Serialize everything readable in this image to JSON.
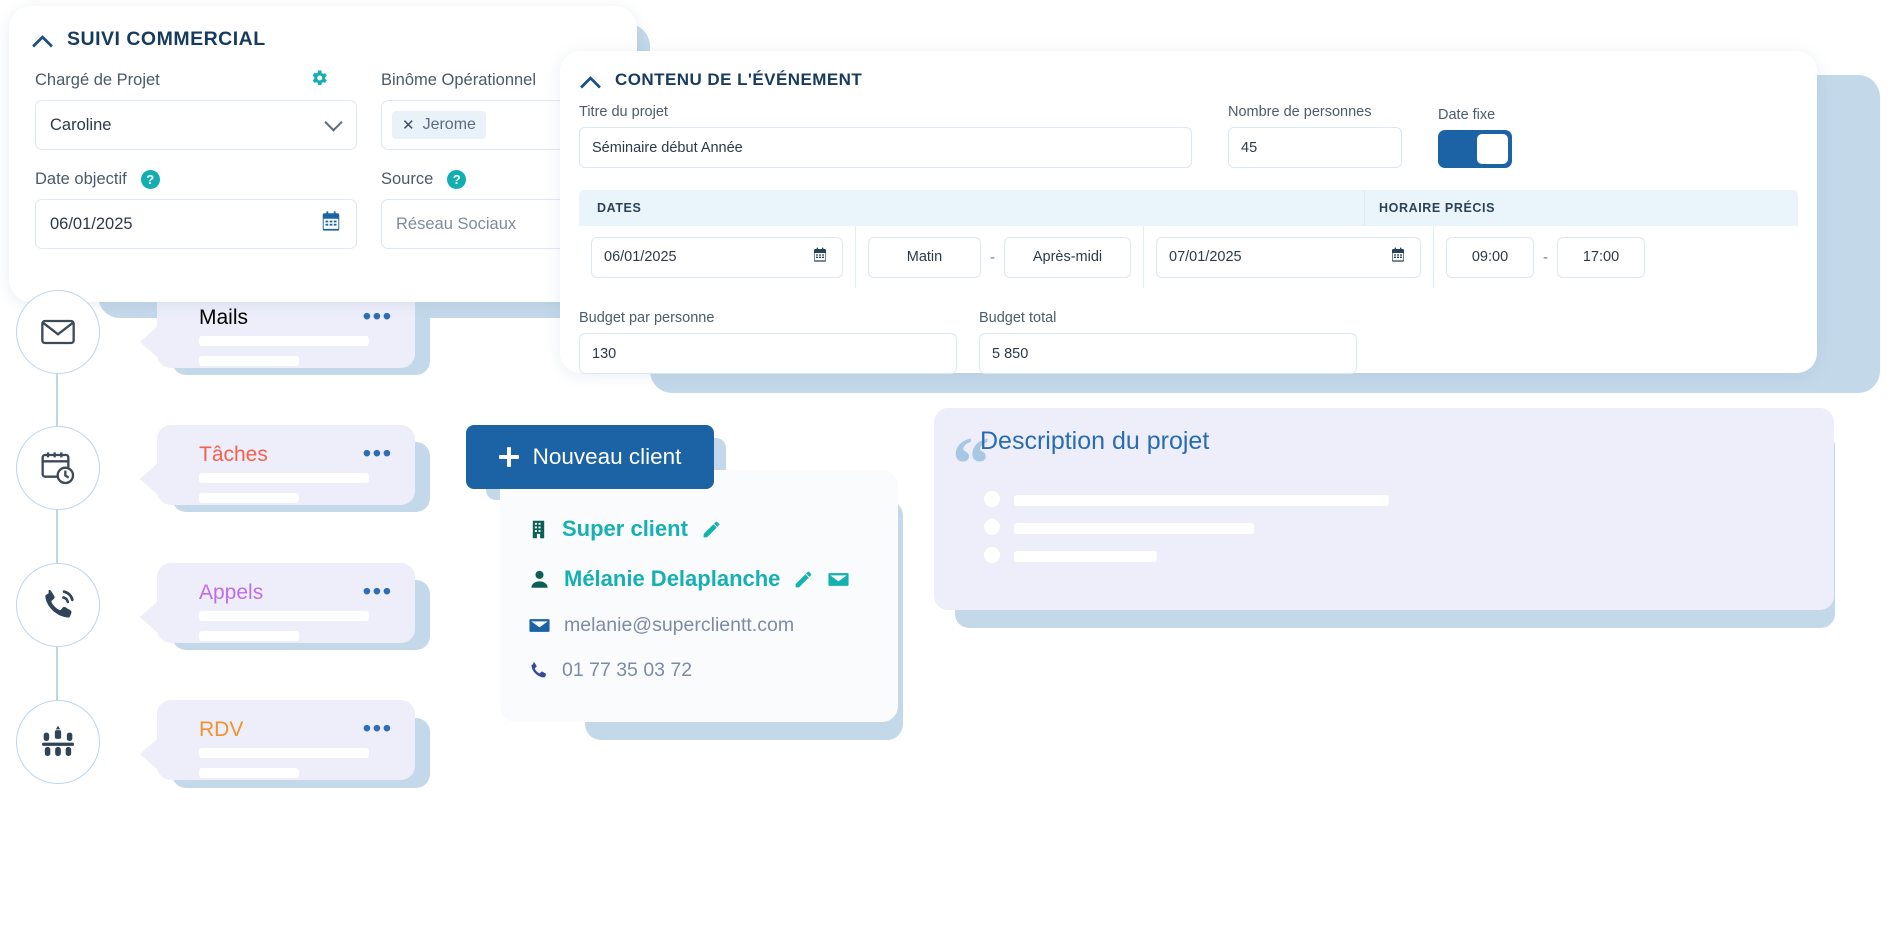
{
  "suivi": {
    "title": "SUIVI COMMERCIAL",
    "collapse_icon": "chevron-up-icon",
    "fields": {
      "charge_projet_label": "Chargé de Projet",
      "charge_projet_value": "Caroline",
      "gear_icon": "gear-icon",
      "binome_label": "Binôme Opérationnel",
      "binome_tag": "Jerome",
      "binome_tag_remove": "✕",
      "date_objectif_label": "Date objectif",
      "date_objectif_value": "06/01/2025",
      "date_objectif_help": "?",
      "source_label": "Source",
      "source_help": "?",
      "source_value": "Réseau Sociaux"
    }
  },
  "event": {
    "title": "CONTENU DE L'ÉVÉNEMENT",
    "collapse_icon": "chevron-up-icon",
    "titre_projet_label": "Titre du projet",
    "titre_projet_value": "Séminaire début Année",
    "nombre_personnes_label": "Nombre de personnes",
    "nombre_personnes_value": "45",
    "date_fixe_label": "Date fixe",
    "date_fixe_state": "on",
    "table": {
      "col_dates": "DATES",
      "col_horaire": "HORAIRE PRÉCIS",
      "start_date": "06/01/2025",
      "start_period": "Matin",
      "period_separator": "-",
      "end_period": "Après-midi",
      "end_date": "07/01/2025",
      "start_time": "09:00",
      "time_separator": "-",
      "end_time": "17:00"
    },
    "budget_personne_label": "Budget par personne",
    "budget_personne_value": "130",
    "budget_total_label": "Budget total",
    "budget_total_value": "5 850"
  },
  "timeline": [
    {
      "icon": "envelope-icon",
      "label": "Mails",
      "color": "#2b6cb0",
      "menu": "•••"
    },
    {
      "icon": "calendar-clock-icon",
      "label": "Tâches",
      "color": "#f4604f",
      "menu": "•••"
    },
    {
      "icon": "phone-ring-icon",
      "label": "Appels",
      "color": "#c06ee8",
      "menu": "•••"
    },
    {
      "icon": "meeting-table-icon",
      "label": "RDV",
      "color": "#f29132",
      "menu": "•••"
    }
  ],
  "client": {
    "new_client_button": "Nouveau client",
    "new_client_icon": "plus-icon",
    "company_icon": "building-icon",
    "company_name": "Super client",
    "company_edit_icon": "pencil-icon",
    "contact_icon": "person-icon",
    "contact_name": "Mélanie Delaplanche",
    "contact_edit_icon": "pencil-icon",
    "contact_mail_icon": "envelope-icon",
    "email_icon": "envelope-icon",
    "email": "melanie@superclientt.com",
    "phone_icon": "phone-icon",
    "phone": "01 77 35 03 72"
  },
  "description": {
    "quote_icon": "quote-mark-icon",
    "title": "Description du projet"
  },
  "colors": {
    "brand_blue": "#1b63a5",
    "teal": "#13aeb2",
    "navy": "#173b5e",
    "bubble_bg": "#edeefa",
    "shadow_blue": "#c3d9ea"
  }
}
